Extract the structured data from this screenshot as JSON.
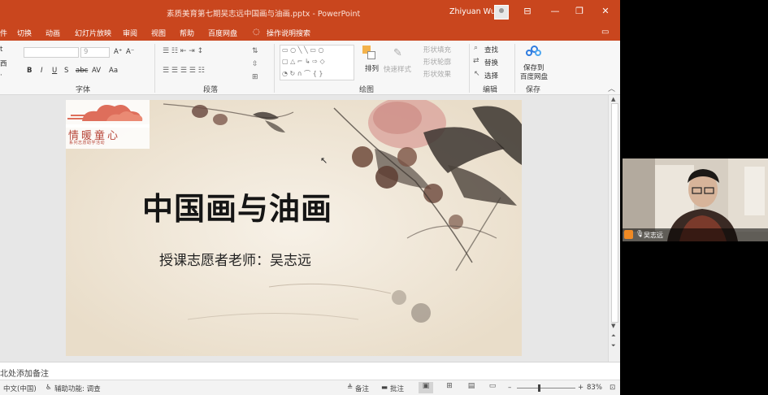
{
  "app": {
    "document_title": "素质美育第七期吴志远中国画与油画.pptx  -  PowerPoint",
    "user_name": "Zhiyuan Wu",
    "window_buttons": {
      "ribbon_display": "⊟",
      "minimize": "—",
      "restore": "❐",
      "close": "✕"
    }
  },
  "menu": {
    "items": [
      "件",
      "切换",
      "动画",
      "幻灯片放映",
      "审阅",
      "视图",
      "帮助",
      "百度网盘",
      "操作说明搜索"
    ],
    "tell_me_icon": "lightbulb-icon",
    "comments_icon": "comment-icon"
  },
  "ribbon": {
    "groups": {
      "font": "字体",
      "paragraph": "段落",
      "drawing": "绘图",
      "editing": "编辑",
      "save": "保存"
    },
    "font_size_value": "9",
    "font_buttons": [
      "A⁺",
      "A⁻",
      "B",
      "I",
      "U",
      "S",
      "abc",
      "AV",
      "Aa"
    ],
    "drawing": {
      "arrange": "排列",
      "quick_styles": "快速样式",
      "shape_fill": "形状填充",
      "shape_outline": "形状轮廓",
      "shape_effects": "形状效果"
    },
    "editing": {
      "find": "查找",
      "replace": "替换",
      "select": "选择"
    },
    "save": {
      "label_line1": "保存到",
      "label_line2": "百度网盘"
    },
    "left_partial": [
      "t",
      "西",
      "·"
    ]
  },
  "slide": {
    "title": "中国画与油画",
    "subtitle": "授课志愿者老师：吴志远",
    "logo_text": "情暖童心",
    "logo_subtext": "系列志愿助学活动"
  },
  "notes": {
    "placeholder": "北处添加备注"
  },
  "status": {
    "language": "中文(中国)",
    "accessibility": "辅助功能: 调查",
    "notes_button": "备注",
    "comments_button": "批注",
    "zoom_percent": "83%",
    "zoom_level": 0.45
  },
  "webcam": {
    "name": "吴志远"
  },
  "colors": {
    "accent": "#c9461e",
    "slide_bg": "#f3ebde",
    "logo_red": "#b8473a"
  }
}
